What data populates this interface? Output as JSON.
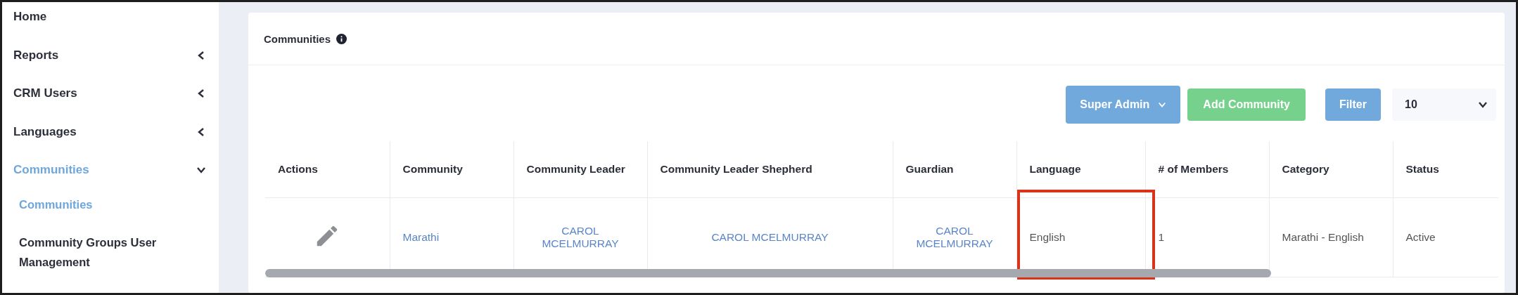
{
  "sidebar": {
    "items": [
      {
        "label": "Home",
        "has_arrow": false,
        "expanded": false,
        "selected": false
      },
      {
        "label": "Reports",
        "has_arrow": true,
        "expanded": false,
        "selected": false
      },
      {
        "label": "CRM Users",
        "has_arrow": true,
        "expanded": false,
        "selected": false
      },
      {
        "label": "Languages",
        "has_arrow": true,
        "expanded": false,
        "selected": false
      },
      {
        "label": "Communities",
        "has_arrow": true,
        "expanded": true,
        "selected": true,
        "children": [
          {
            "label": "Communities",
            "selected": true
          },
          {
            "label": "Community Groups User Management",
            "selected": false
          }
        ]
      }
    ]
  },
  "card": {
    "title": "Communities",
    "toolbar": {
      "role_dropdown": "Super Admin",
      "add_button": "Add Community",
      "filter_button": "Filter",
      "page_size": "10"
    },
    "table": {
      "columns": [
        "Actions",
        "Community",
        "Community Leader",
        "Community Leader Shepherd",
        "Guardian",
        "Language",
        "# of Members",
        "Category",
        "Status"
      ],
      "rows": [
        {
          "cells": [
            {
              "kind": "icon",
              "highlighted": false
            },
            {
              "kind": "link",
              "text": "Marathi",
              "highlighted": false
            },
            {
              "kind": "link",
              "text": "CAROL MCELMURRAY",
              "highlighted": false
            },
            {
              "kind": "link",
              "text": "CAROL MCELMURRAY",
              "highlighted": false
            },
            {
              "kind": "link",
              "text": "CAROL MCELMURRAY",
              "highlighted": false
            },
            {
              "kind": "text",
              "text": "English",
              "highlighted": true
            },
            {
              "kind": "text",
              "text": "1",
              "highlighted": false
            },
            {
              "kind": "text",
              "text": "Marathi - English",
              "highlighted": false
            },
            {
              "kind": "text",
              "text": "Active",
              "highlighted": false
            }
          ]
        }
      ]
    }
  }
}
